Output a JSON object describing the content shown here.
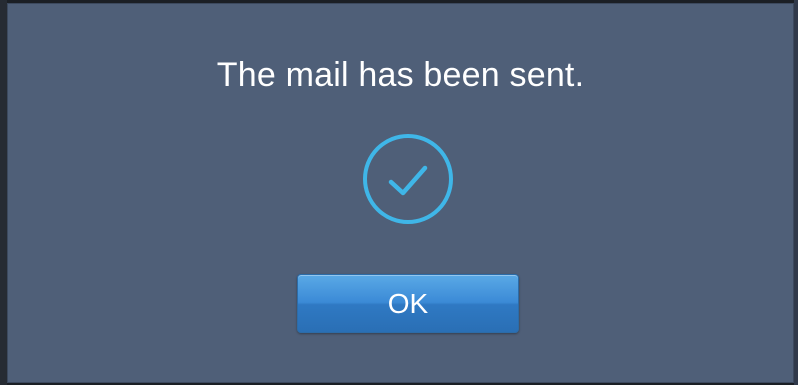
{
  "dialog": {
    "message": "The mail has been sent.",
    "icon": "checkmark-circle-icon",
    "ok_label": "OK"
  },
  "colors": {
    "background": "#4f5f78",
    "accent": "#3fb6e8",
    "button": "#3b8ad6",
    "text": "#ffffff"
  }
}
